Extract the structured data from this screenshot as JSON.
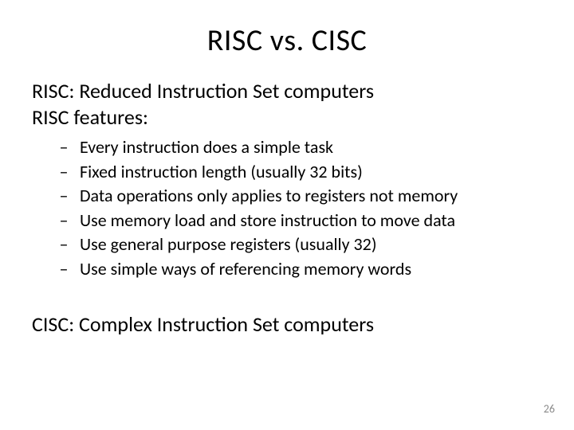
{
  "title": "RISC vs. CISC",
  "line1": "RISC: Reduced Instruction Set computers",
  "line2": "RISC features:",
  "bullets": [
    "Every instruction does a simple task",
    "Fixed instruction length (usually 32 bits)",
    "Data operations only applies to registers not memory",
    "Use memory load and store instruction to move data",
    "Use general purpose registers (usually 32)",
    "Use simple ways of referencing memory words"
  ],
  "cisc": "CISC: Complex Instruction Set computers",
  "page_number": "26",
  "dash": "–"
}
